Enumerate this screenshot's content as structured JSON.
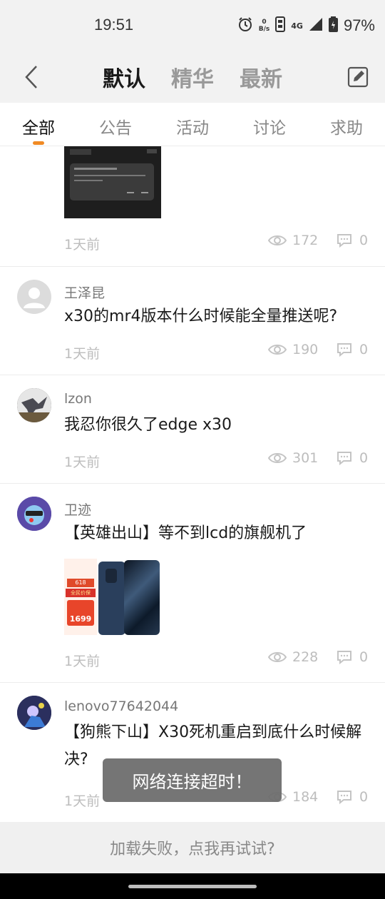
{
  "status_bar": {
    "time": "19:51",
    "net_speed_top": "0",
    "net_speed_bottom": "B/s",
    "network_type": "4G",
    "battery": "97%"
  },
  "header": {
    "tabs": [
      {
        "label": "默认",
        "active": true
      },
      {
        "label": "精华",
        "active": false
      },
      {
        "label": "最新",
        "active": false
      }
    ]
  },
  "category_tabs": [
    {
      "label": "全部",
      "active": true
    },
    {
      "label": "公告",
      "active": false
    },
    {
      "label": "活动",
      "active": false
    },
    {
      "label": "讨论",
      "active": false
    },
    {
      "label": "求助",
      "active": false
    }
  ],
  "posts": [
    {
      "author": "",
      "title": "",
      "time": "1天前",
      "views": "172",
      "comments": "0",
      "image": "dialog-screenshot"
    },
    {
      "author": "王泽昆",
      "title": "x30的mr4版本什么时候能全量推送呢?",
      "time": "1天前",
      "views": "190",
      "comments": "0"
    },
    {
      "author": "lzon",
      "title": "我忍你很久了edge x30",
      "time": "1天前",
      "views": "301",
      "comments": "0"
    },
    {
      "author": "卫迹",
      "title": "【英雄出山】等不到lcd的旗舰机了",
      "time": "1天前",
      "views": "228",
      "comments": "0",
      "image": "phone-promo"
    },
    {
      "author": "lenovo77642044",
      "title": "【狗熊下山】X30死机重启到底什么时候解决?",
      "time": "1天前",
      "views": "184",
      "comments": "0"
    }
  ],
  "promo_image": {
    "tag1": "618",
    "tag2": "全民价保",
    "price": "1699"
  },
  "toast": "网络连接超时！",
  "load_fail": "加载失败，点我再试试?",
  "colors": {
    "accent": "#f08a24",
    "header_bg": "#f2f2f2",
    "muted": "#bdbdbd"
  }
}
